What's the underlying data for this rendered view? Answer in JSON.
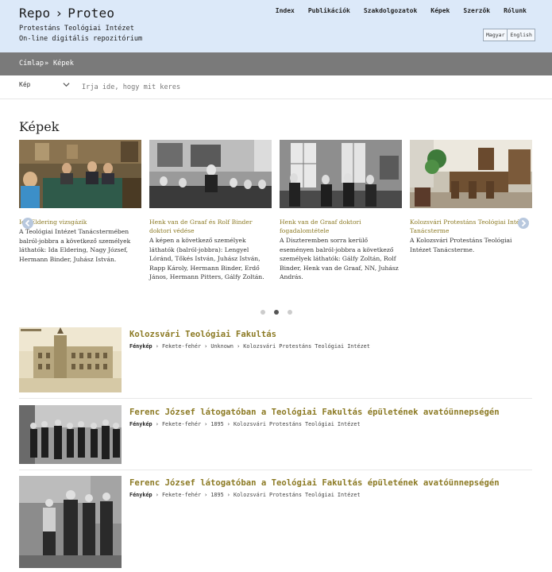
{
  "site": {
    "brand_left": "Repo",
    "brand_sep": "›",
    "brand_right": "Proteo",
    "tagline1": "Protestáns Teológiai Intézet",
    "tagline2": "On-line digitális repozitórium"
  },
  "nav": {
    "items": [
      "Index",
      "Publikációk",
      "Szakdolgozatok",
      "Képek",
      "Szerzők",
      "Rólunk"
    ]
  },
  "lang": {
    "hu": "Magyar",
    "en": "English"
  },
  "breadcrumb": {
    "home": "Címlap",
    "sep": "»",
    "current": "Képek"
  },
  "search": {
    "type_value": "Kép",
    "placeholder": "Írja ide, hogy mit keres"
  },
  "page_title": "Képek",
  "carousel": {
    "cards": [
      {
        "title": "Ida Eldering vizsgázik",
        "desc": "A Teológiai Intézet Tanácstermében balról-jobbra a következő személyek láthatók: Ida Eldering, Nagy József, Hermann Binder, Juhász István."
      },
      {
        "title": "Henk van de Graaf és Rolf Binder doktori védése",
        "desc": "A képen a következő személyek láthatók (balról-jobbra): Lengyel Lóránd, Tőkés István, Juhász István, Rapp Károly, Hermann Binder, Erdő János, Hermann Pitters, Gálfy Zoltán."
      },
      {
        "title": "Henk van de Graaf doktori fogadalomtétele",
        "desc": "A Diszteremben sorra kerülő eseményen balról-jobbra a következő személyek láthatók: Gálfy Zoltán, Rolf Binder, Henk van de Graaf, NN, Juhász András."
      },
      {
        "title": "Kolozsvári Protestáns Teológiai Intézet Tanácsterme",
        "desc": "A Kolozsvári Protestáns Teológiai Intézet Tanácsterme."
      }
    ],
    "dots": 3,
    "active_dot": 1
  },
  "list": {
    "items": [
      {
        "title": "Kolozsvári Teológiai Fakultás",
        "kind": "Fénykép",
        "color": "Fekete-fehér",
        "year": "Unknown",
        "source": "Kolozsvári Protestáns Teológiai Intézet"
      },
      {
        "title": "Ferenc József látogatóban a Teológiai Fakultás épületének avatóünnepségén",
        "kind": "Fénykép",
        "color": "Fekete-fehér",
        "year": "1895",
        "source": "Kolozsvári Protestáns Teológiai Intézet"
      },
      {
        "title": "Ferenc József látogatóban a Teológiai Fakultás épületének avatóünnepségén",
        "kind": "Fénykép",
        "color": "Fekete-fehér",
        "year": "1895",
        "source": "Kolozsvári Protestáns Teológiai Intézet"
      }
    ],
    "meta_sep": "›"
  },
  "colors": {
    "header_bg": "#dce9f9",
    "breadcrumb_bg": "#7a7a7a",
    "accent_gold": "#8c7a24",
    "arrow_bg": "#b8c8de"
  }
}
